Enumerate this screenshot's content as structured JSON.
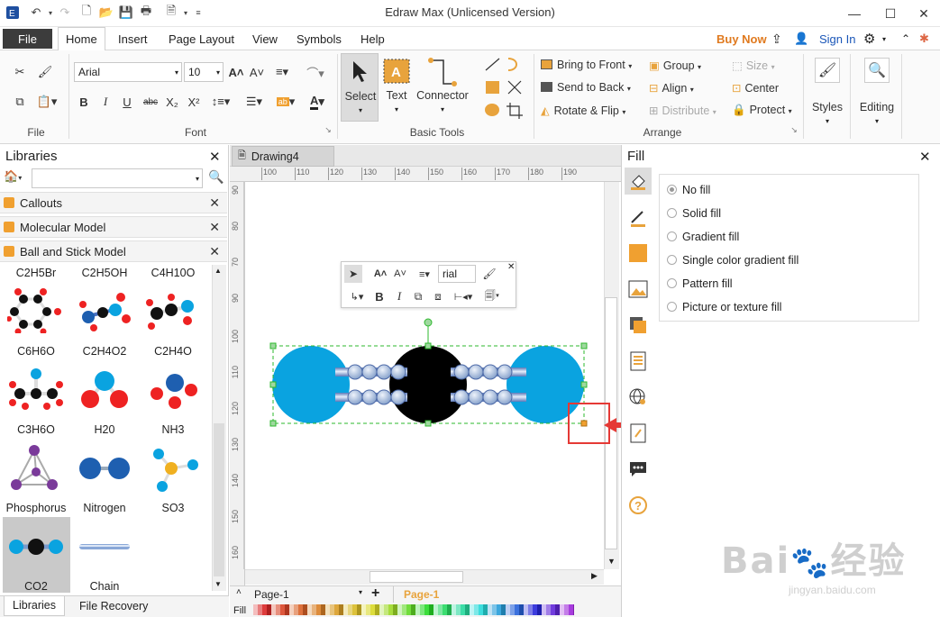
{
  "app": {
    "title": "Edraw Max (Unlicensed Version)"
  },
  "menu": {
    "file": "File",
    "tabs": [
      "Home",
      "Insert",
      "Page Layout",
      "View",
      "Symbols",
      "Help"
    ],
    "buy_now": "Buy Now",
    "sign_in": "Sign In"
  },
  "ribbon": {
    "font_name": "Arial",
    "font_size": "10",
    "groups": {
      "file": "File",
      "font": "Font",
      "basic_tools": "Basic Tools",
      "arrange": "Arrange"
    },
    "tools": {
      "select": "Select",
      "text": "Text",
      "connector": "Connector"
    },
    "arrange": {
      "bring_to_front": "Bring to Front",
      "send_to_back": "Send to Back",
      "rotate_flip": "Rotate & Flip",
      "group": "Group",
      "align": "Align",
      "distribute": "Distribute",
      "size": "Size",
      "center": "Center",
      "protect": "Protect"
    },
    "styles": "Styles",
    "editing": "Editing"
  },
  "libraries": {
    "title": "Libraries",
    "categories": [
      "Callouts",
      "Molecular Model",
      "Ball and Stick Model"
    ],
    "top_labels": [
      "C2H5Br",
      "C2H5OH",
      "C4H10O"
    ],
    "shapes": [
      [
        "C6H6O",
        "C2H4O2",
        "C2H4O"
      ],
      [
        "C3H6O",
        "H20",
        "NH3"
      ],
      [
        "Phosphorus",
        "Nitrogen",
        "SO3"
      ],
      [
        "CO2",
        "Chain"
      ]
    ],
    "footer_tabs": [
      "Libraries",
      "File Recovery"
    ]
  },
  "document": {
    "tab": "Drawing4",
    "ruler_h": [
      "100",
      "110",
      "120",
      "130",
      "140",
      "150",
      "160",
      "170",
      "180",
      "190"
    ],
    "ruler_v": [
      "90",
      "80",
      "70",
      "90",
      "100",
      "110",
      "120",
      "130",
      "140",
      "150",
      "160"
    ],
    "float_font": "rial",
    "page_select": "Page-1",
    "page_tab": "Page-1",
    "fill_label": "Fill"
  },
  "fill_panel": {
    "title": "Fill",
    "options": [
      "No fill",
      "Solid fill",
      "Gradient fill",
      "Single color gradient fill",
      "Pattern fill",
      "Picture or texture fill"
    ],
    "selected": "No fill"
  },
  "colors": {
    "accent_orange": "#e8a33c",
    "buy_now": "#e07a1f",
    "molecule_blue": "#0aa3e0",
    "highlight_red": "#e53935"
  },
  "watermark": {
    "text": "Baidu经验",
    "sub": "jingyan.baidu.com"
  }
}
